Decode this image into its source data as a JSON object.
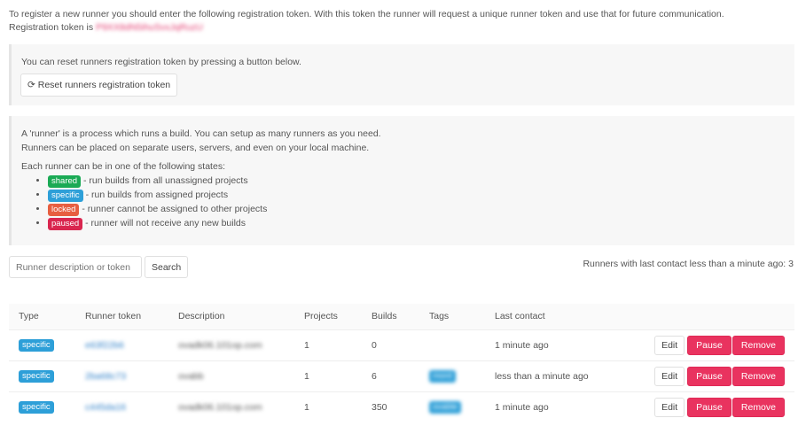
{
  "intro": "To register a new runner you should enter the following registration token. With this token the runner will request a unique runner token and use that for future communication.",
  "token_label": "Registration token is",
  "token_value": "P9XX8dN5ihuSvxJqRuzU",
  "reset": {
    "text": "You can reset runners registration token by pressing a button below.",
    "button": "Reset runners registration token"
  },
  "info": {
    "line1": "A 'runner' is a process which runs a build. You can setup as many runners as you need.",
    "line2": "Runners can be placed on separate users, servers, and even on your local machine.",
    "states_title": "Each runner can be in one of the following states:",
    "states": [
      {
        "label": "shared",
        "desc": "- run builds from all unassigned projects",
        "color": "#1aaa55"
      },
      {
        "label": "specific",
        "desc": "- run builds from assigned projects",
        "color": "#2d9fd8"
      },
      {
        "label": "locked",
        "desc": "- runner cannot be assigned to other projects",
        "color": "#e75e40"
      },
      {
        "label": "paused",
        "desc": "- runner will not receive any new builds",
        "color": "#d9264f"
      }
    ]
  },
  "search": {
    "placeholder": "Runner description or token",
    "button": "Search"
  },
  "contact_summary": "Runners with last contact less than a minute ago: 3",
  "table": {
    "headers": [
      "Type",
      "Runner token",
      "Description",
      "Projects",
      "Builds",
      "Tags",
      "Last contact"
    ],
    "rows": [
      {
        "type": "specific",
        "token": "e63f22b6",
        "description": "ovadk06.101op.com",
        "projects": "1",
        "builds": "0",
        "tag": "",
        "last": "1 minute ago"
      },
      {
        "type": "specific",
        "token": "2ba68c73",
        "description": "ovabb",
        "projects": "1",
        "builds": "6",
        "tag": "mord",
        "last": "less than a minute ago"
      },
      {
        "type": "specific",
        "token": "c445da16",
        "description": "ovadk06.101op.com",
        "projects": "1",
        "builds": "350",
        "tag": "ovable",
        "last": "1 minute ago"
      }
    ],
    "actions": {
      "edit": "Edit",
      "pause": "Pause",
      "remove": "Remove"
    }
  }
}
